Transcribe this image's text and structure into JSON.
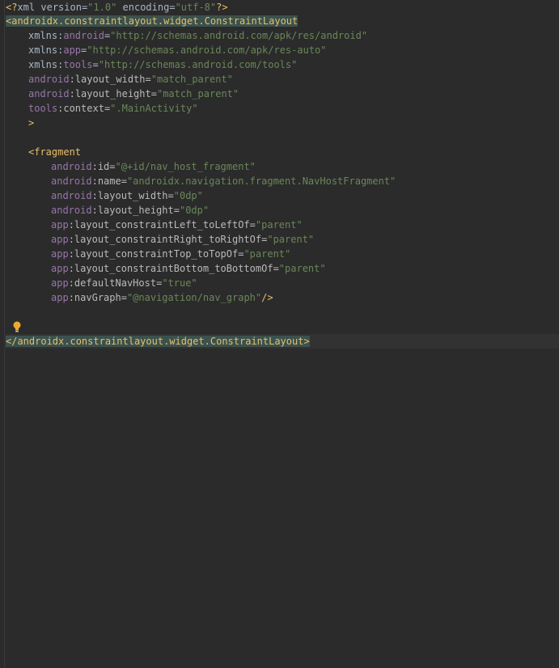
{
  "editor": {
    "lines": {
      "l1": {
        "open": "<?",
        "name": "xml",
        "a1": " version",
        "eq1": "=",
        "v1": "\"1.0\"",
        "a2": " encoding",
        "eq2": "=",
        "v2": "\"utf-8\"",
        "close": "?>"
      },
      "l2": {
        "open": "<",
        "name": "androidx.constraintlayout.widget.ConstraintLayout"
      },
      "l3": {
        "ns": "xmlns",
        "colon": ":",
        "attr": "android",
        "eq": "=",
        "val": "\"http://schemas.android.com/apk/res/android\""
      },
      "l4": {
        "ns": "xmlns",
        "colon": ":",
        "attr": "app",
        "eq": "=",
        "val": "\"http://schemas.android.com/apk/res-auto\""
      },
      "l5": {
        "ns": "xmlns",
        "colon": ":",
        "attr": "tools",
        "eq": "=",
        "val": "\"http://schemas.android.com/tools\""
      },
      "l6": {
        "ns": "android",
        "colon": ":",
        "attr": "layout_width",
        "eq": "=",
        "val": "\"match_parent\""
      },
      "l7": {
        "ns": "android",
        "colon": ":",
        "attr": "layout_height",
        "eq": "=",
        "val": "\"match_parent\""
      },
      "l8": {
        "ns": "tools",
        "colon": ":",
        "attr": "context",
        "eq": "=",
        "val": "\".MainActivity\""
      },
      "l9": {
        "close": ">"
      },
      "l11": {
        "open": "<",
        "name": "fragment"
      },
      "l12": {
        "ns": "android",
        "colon": ":",
        "attr": "id",
        "eq": "=",
        "val": "\"@+id/nav_host_fragment\""
      },
      "l13": {
        "ns": "android",
        "colon": ":",
        "attr": "name",
        "eq": "=",
        "val": "\"androidx.navigation.fragment.NavHostFragment\""
      },
      "l14": {
        "ns": "android",
        "colon": ":",
        "attr": "layout_width",
        "eq": "=",
        "val": "\"0dp\""
      },
      "l15": {
        "ns": "android",
        "colon": ":",
        "attr": "layout_height",
        "eq": "=",
        "val": "\"0dp\""
      },
      "l16": {
        "ns": "app",
        "colon": ":",
        "attr": "layout_constraintLeft_toLeftOf",
        "eq": "=",
        "val": "\"parent\""
      },
      "l17": {
        "ns": "app",
        "colon": ":",
        "attr": "layout_constraintRight_toRightOf",
        "eq": "=",
        "val": "\"parent\""
      },
      "l18": {
        "ns": "app",
        "colon": ":",
        "attr": "layout_constraintTop_toTopOf",
        "eq": "=",
        "val": "\"parent\""
      },
      "l19": {
        "ns": "app",
        "colon": ":",
        "attr": "layout_constraintBottom_toBottomOf",
        "eq": "=",
        "val": "\"parent\""
      },
      "l20": {
        "ns": "app",
        "colon": ":",
        "attr": "defaultNavHost",
        "eq": "=",
        "val": "\"true\""
      },
      "l21": {
        "ns": "app",
        "colon": ":",
        "attr": "navGraph",
        "eq": "=",
        "val": "\"@navigation/nav_graph\"",
        "close": "/>"
      },
      "l24": {
        "open": "</",
        "name": "androidx.constraintlayout.widget.ConstraintLayout",
        "close": ">"
      }
    },
    "icons": {
      "bulb": "lightbulb-icon"
    },
    "colors": {
      "background": "#2b2b2b",
      "tag": "#e8bf6a",
      "namespace": "#9876aa",
      "attribute": "#bababa",
      "value": "#6a8759",
      "text": "#a9b7c6",
      "tag_highlight": "#3b514d",
      "current_line": "#323232",
      "bulb": "#f0a732"
    }
  }
}
